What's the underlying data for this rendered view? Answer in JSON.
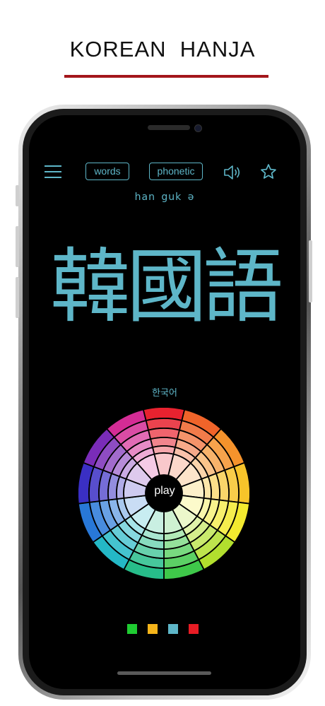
{
  "header": {
    "title": "KOREAN  HANJA",
    "rule_color": "#a3161b"
  },
  "toolbar": {
    "menu_icon": "hamburger-menu-icon",
    "words_label": "words",
    "phonetic_label": "phonetic",
    "sound_icon": "speaker-sound-icon",
    "favorite_icon": "star-outline-icon"
  },
  "content": {
    "phonetic": "han guk ə",
    "hanja": "韓國語",
    "hangul": "한국어",
    "play_label": "play"
  },
  "colors": {
    "accent": "#5eb6c8",
    "screen_bg": "#000000",
    "wheel_hues": [
      "#e8222f",
      "#f0642a",
      "#f5932c",
      "#f7c42a",
      "#f3ea2f",
      "#b2df2e",
      "#3fc84a",
      "#27bd8a",
      "#24b8c6",
      "#2878d8",
      "#3a2fc4",
      "#7a2cb8",
      "#d42c95"
    ],
    "swatches": [
      "#1fcc32",
      "#f5b41a",
      "#5eb6c8",
      "#e81c24"
    ]
  }
}
